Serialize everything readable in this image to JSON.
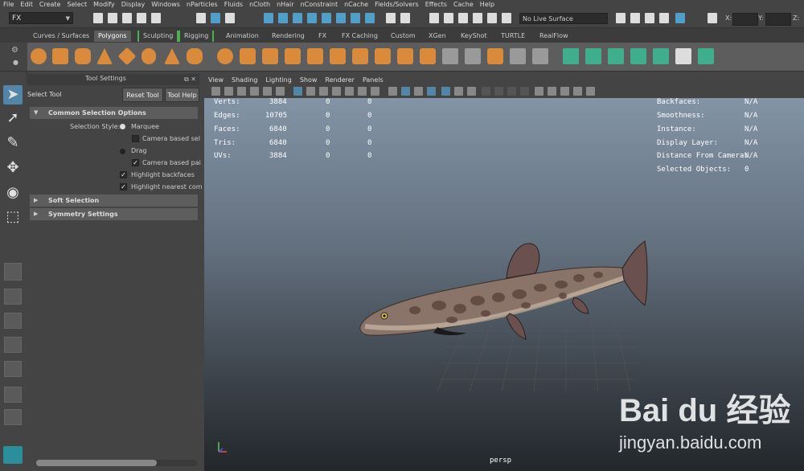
{
  "menu": [
    "File",
    "Edit",
    "Create",
    "Select",
    "Modify",
    "Display",
    "Windows",
    "nParticles",
    "Fluids",
    "nCloth",
    "nHair",
    "nConstraint",
    "nCache",
    "Fields/Solvers",
    "Effects",
    "Cache",
    "Help"
  ],
  "status": {
    "mode": "FX",
    "live_surface": "No Live Surface",
    "coord_x_label": "X:",
    "coord_y_label": "Y:",
    "coord_z_label": "Z:"
  },
  "shelf_tabs": [
    "Curves / Surfaces",
    "Polygons",
    "Sculpting",
    "Rigging",
    "Animation",
    "Rendering",
    "FX",
    "FX Caching",
    "Custom",
    "XGen",
    "KeyShot",
    "TURTLE",
    "RealFlow"
  ],
  "shelf_active": "Polygons",
  "tool_settings": {
    "title": "Tool Settings",
    "tool_name": "Select Tool",
    "reset_label": "Reset Tool",
    "help_label": "Tool Help",
    "section_common": "Common Selection Options",
    "selection_style_label": "Selection Style:",
    "marquee_label": "Marquee",
    "camera_based_sel_label": "Camera based sel",
    "drag_label": "Drag",
    "camera_based_pai_label": "Camera based pai",
    "highlight_backfaces_label": "Highlight backfaces",
    "highlight_nearest_label": "Highlight nearest com",
    "section_soft": "Soft Selection",
    "section_symmetry": "Symmetry Settings"
  },
  "viewport": {
    "menu": [
      "View",
      "Shading",
      "Lighting",
      "Show",
      "Renderer",
      "Panels"
    ],
    "camera_label": "persp",
    "hud_left": [
      {
        "label": "Verts:",
        "v1": "3884",
        "v2": "0",
        "v3": "0"
      },
      {
        "label": "Edges:",
        "v1": "10705",
        "v2": "0",
        "v3": "0"
      },
      {
        "label": "Faces:",
        "v1": "6840",
        "v2": "0",
        "v3": "0"
      },
      {
        "label": "Tris:",
        "v1": "6840",
        "v2": "0",
        "v3": "0"
      },
      {
        "label": "UVs:",
        "v1": "3884",
        "v2": "0",
        "v3": "0"
      }
    ],
    "hud_right": [
      {
        "label": "Backfaces:",
        "value": "N/A"
      },
      {
        "label": "Smoothness:",
        "value": "N/A"
      },
      {
        "label": "Instance:",
        "value": "N/A"
      },
      {
        "label": "Display Layer:",
        "value": "N/A"
      },
      {
        "label": "Distance From Camera:",
        "value": "N/A"
      },
      {
        "label": "Selected Objects:",
        "value": "0"
      }
    ]
  },
  "watermark": {
    "logo": "Bai du 经验",
    "url": "jingyan.baidu.com"
  }
}
